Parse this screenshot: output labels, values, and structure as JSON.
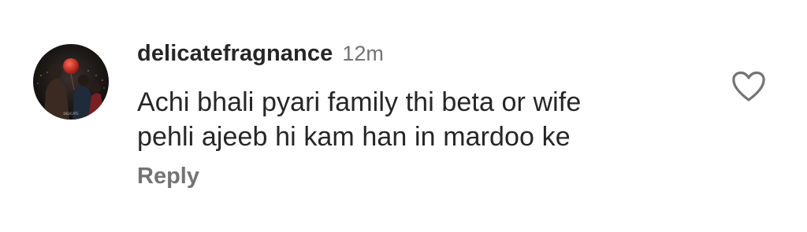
{
  "comment": {
    "username": "delicatefragnance",
    "timestamp": "12m",
    "text_lines": [
      "Achi bhali pyari family thi beta or wife",
      "pehli ajeeb hi kam han in mardoo ke"
    ],
    "reply_label": "Reply",
    "like_icon": "heart-outline-icon"
  },
  "colors": {
    "primary_text": "#262626",
    "secondary_text": "#737373",
    "background": "#ffffff"
  }
}
